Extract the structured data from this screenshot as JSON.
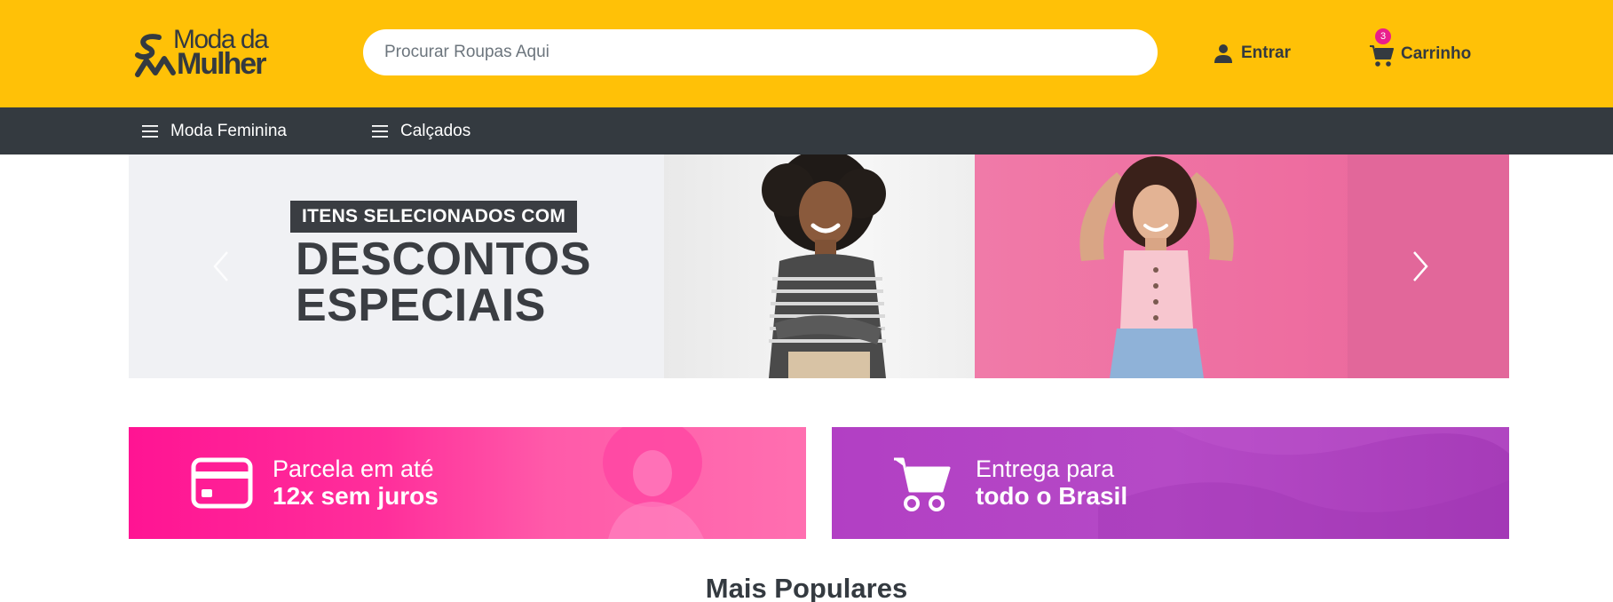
{
  "brand": {
    "name_line1": "Moda da",
    "name_line2": "Mulher",
    "accent_color": "#ffc107",
    "dark_color": "#343a40"
  },
  "header": {
    "search_placeholder": "Procurar Roupas Aqui",
    "login_label": "Entrar",
    "login_icon": "user-icon",
    "cart_label": "Carrinho",
    "cart_icon": "cart-icon",
    "cart_count": "3"
  },
  "nav": {
    "items": [
      {
        "label": "Moda Feminina",
        "icon": "menu-icon"
      },
      {
        "label": "Calçados",
        "icon": "menu-icon"
      }
    ]
  },
  "carousel": {
    "tag": "ITENS SELECIONADOS COM",
    "headline_line1": "DESCONTOS",
    "headline_line2": "ESPECIAIS",
    "prev_icon": "chevron-left-icon",
    "next_icon": "chevron-right-icon"
  },
  "promos": [
    {
      "line1": "Parcela em até",
      "line2": "12x sem juros",
      "icon": "credit-card-icon",
      "color": "#ff1493"
    },
    {
      "line1": "Entrega para",
      "line2": "todo o Brasil",
      "icon": "cart-icon",
      "color": "#b23fc4"
    }
  ],
  "section": {
    "title": "Mais Populares"
  }
}
